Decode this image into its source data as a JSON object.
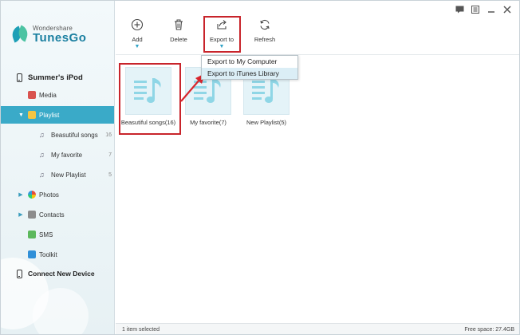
{
  "app": {
    "brand": "Wondershare",
    "product": "TunesGo",
    "logo_icon": "tunesgo-logo-icon"
  },
  "window_controls": {
    "feedback_icon": "message-icon",
    "menu_icon": "menu-icon",
    "minimize_icon": "minimize-icon",
    "close_icon": "close-icon"
  },
  "toolbar": {
    "add_label": "Add",
    "delete_label": "Delete",
    "export_label": "Export to",
    "refresh_label": "Refresh"
  },
  "export_menu": {
    "options": [
      "Export to My Computer",
      "Export to iTunes Library"
    ],
    "highlighted": "Export to iTunes Library"
  },
  "sidebar": {
    "device_name": "Summer's iPod",
    "items": [
      {
        "label": "Media",
        "icon": "media-icon"
      },
      {
        "label": "Playlist",
        "icon": "playlist-icon",
        "active": true
      },
      {
        "label": "Photos",
        "icon": "photos-icon"
      },
      {
        "label": "Contacts",
        "icon": "contacts-icon"
      },
      {
        "label": "SMS",
        "icon": "sms-icon"
      },
      {
        "label": "Toolkit",
        "icon": "toolkit-icon"
      }
    ],
    "playlists": [
      {
        "label": "Beasutiful songs",
        "count": "16"
      },
      {
        "label": "My favorite",
        "count": "7"
      },
      {
        "label": "New Playlist",
        "count": "5"
      }
    ],
    "connect_label": "Connect New Device"
  },
  "content": {
    "cards": [
      {
        "label": "Beasutiful songs(16)",
        "selected": true
      },
      {
        "label": "My favorite(7)",
        "selected": false
      },
      {
        "label": "New Playlist(5)",
        "selected": false
      }
    ]
  },
  "status": {
    "selection": "1 item selected",
    "free_space": "Free space: 27.4GB"
  },
  "colors": {
    "accent": "#3aaac8",
    "highlight_red": "#c8242b",
    "thumb_bg": "#e4f3f8",
    "note_color": "#8fd6e6"
  }
}
